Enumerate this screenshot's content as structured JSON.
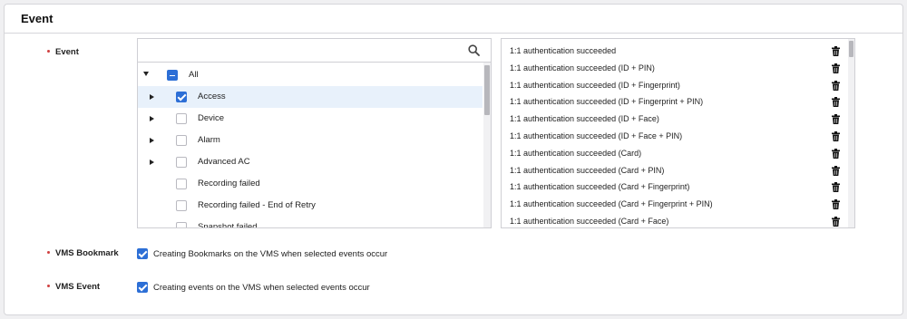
{
  "section": {
    "title": "Event"
  },
  "event_field": {
    "label": "Event",
    "search": {
      "placeholder": "",
      "value": ""
    },
    "tree": [
      {
        "label": "All",
        "state": "indeterminate",
        "expander": "expanded"
      },
      {
        "label": "Access",
        "state": "checked",
        "expander": "collapsed",
        "selected": true
      },
      {
        "label": "Device",
        "state": "unchecked",
        "expander": "collapsed"
      },
      {
        "label": "Alarm",
        "state": "unchecked",
        "expander": "collapsed"
      },
      {
        "label": "Advanced AC",
        "state": "unchecked",
        "expander": "collapsed"
      },
      {
        "label": "Recording failed",
        "state": "unchecked",
        "expander": "none"
      },
      {
        "label": "Recording failed - End of Retry",
        "state": "unchecked",
        "expander": "none"
      },
      {
        "label": "Snapshot failed",
        "state": "unchecked",
        "expander": "none"
      }
    ],
    "selected_events": [
      "1:1 authentication succeeded",
      "1:1 authentication succeeded (ID + PIN)",
      "1:1 authentication succeeded (ID + Fingerprint)",
      "1:1 authentication succeeded (ID + Fingerprint + PIN)",
      "1:1 authentication succeeded (ID + Face)",
      "1:1 authentication succeeded (ID + Face + PIN)",
      "1:1 authentication succeeded (Card)",
      "1:1 authentication succeeded (Card + PIN)",
      "1:1 authentication succeeded (Card + Fingerprint)",
      "1:1 authentication succeeded (Card + Fingerprint + PIN)",
      "1:1 authentication succeeded (Card + Face)"
    ],
    "delete_icon": "trash-icon"
  },
  "vms_bookmark": {
    "label": "VMS Bookmark",
    "checked": true,
    "text": "Creating Bookmarks on the VMS when selected events occur"
  },
  "vms_event": {
    "label": "VMS Event",
    "checked": true,
    "text": "Creating events on the VMS when selected events occur"
  },
  "colors": {
    "accent": "#2d6fd6",
    "selected_row": "#e8f1fb",
    "required_dot": "#d04040"
  }
}
